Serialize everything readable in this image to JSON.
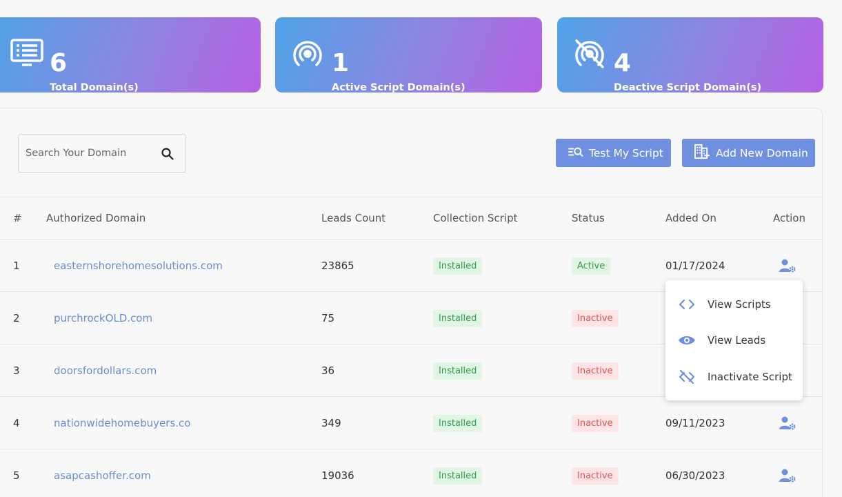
{
  "stats": [
    {
      "value": "6",
      "label": "Total Domain(s)",
      "icon": "monitor-icon"
    },
    {
      "value": "1",
      "label": "Active Script Domain(s)",
      "icon": "broadcast-icon"
    },
    {
      "value": "4",
      "label": "Deactive Script Domain(s)",
      "icon": "broadcast-off-icon"
    }
  ],
  "toolbar": {
    "search_placeholder": "Search Your Domain",
    "test_script_label": "Test My Script",
    "add_domain_label": "Add New Domain"
  },
  "table": {
    "headers": [
      "#",
      "Authorized Domain",
      "Leads Count",
      "Collection Script",
      "Status",
      "Added On",
      "Action"
    ],
    "rows": [
      {
        "num": "1",
        "domain": "easternshorehomesolutions.com",
        "leads": "23865",
        "script": "Installed",
        "status": "Active",
        "added": "01/17/2024"
      },
      {
        "num": "2",
        "domain": "purchrockOLD.com",
        "leads": "75",
        "script": "Installed",
        "status": "Inactive",
        "added": ""
      },
      {
        "num": "3",
        "domain": "doorsfordollars.com",
        "leads": "36",
        "script": "Installed",
        "status": "Inactive",
        "added": ""
      },
      {
        "num": "4",
        "domain": "nationwidehomebuyers.co",
        "leads": "349",
        "script": "Installed",
        "status": "Inactive",
        "added": "09/11/2023"
      },
      {
        "num": "5",
        "domain": "asapcashoffer.com",
        "leads": "19036",
        "script": "Installed",
        "status": "Inactive",
        "added": "06/30/2023"
      }
    ]
  },
  "menu": {
    "items": [
      {
        "label": "View Scripts",
        "icon": "code-icon"
      },
      {
        "label": "View Leads",
        "icon": "eye-icon"
      },
      {
        "label": "Inactivate Script",
        "icon": "code-off-icon"
      }
    ]
  },
  "colors": {
    "accent": "#6f8fe0",
    "link": "#6a8ccf",
    "success": "#2f9c48",
    "danger": "#e25050"
  }
}
